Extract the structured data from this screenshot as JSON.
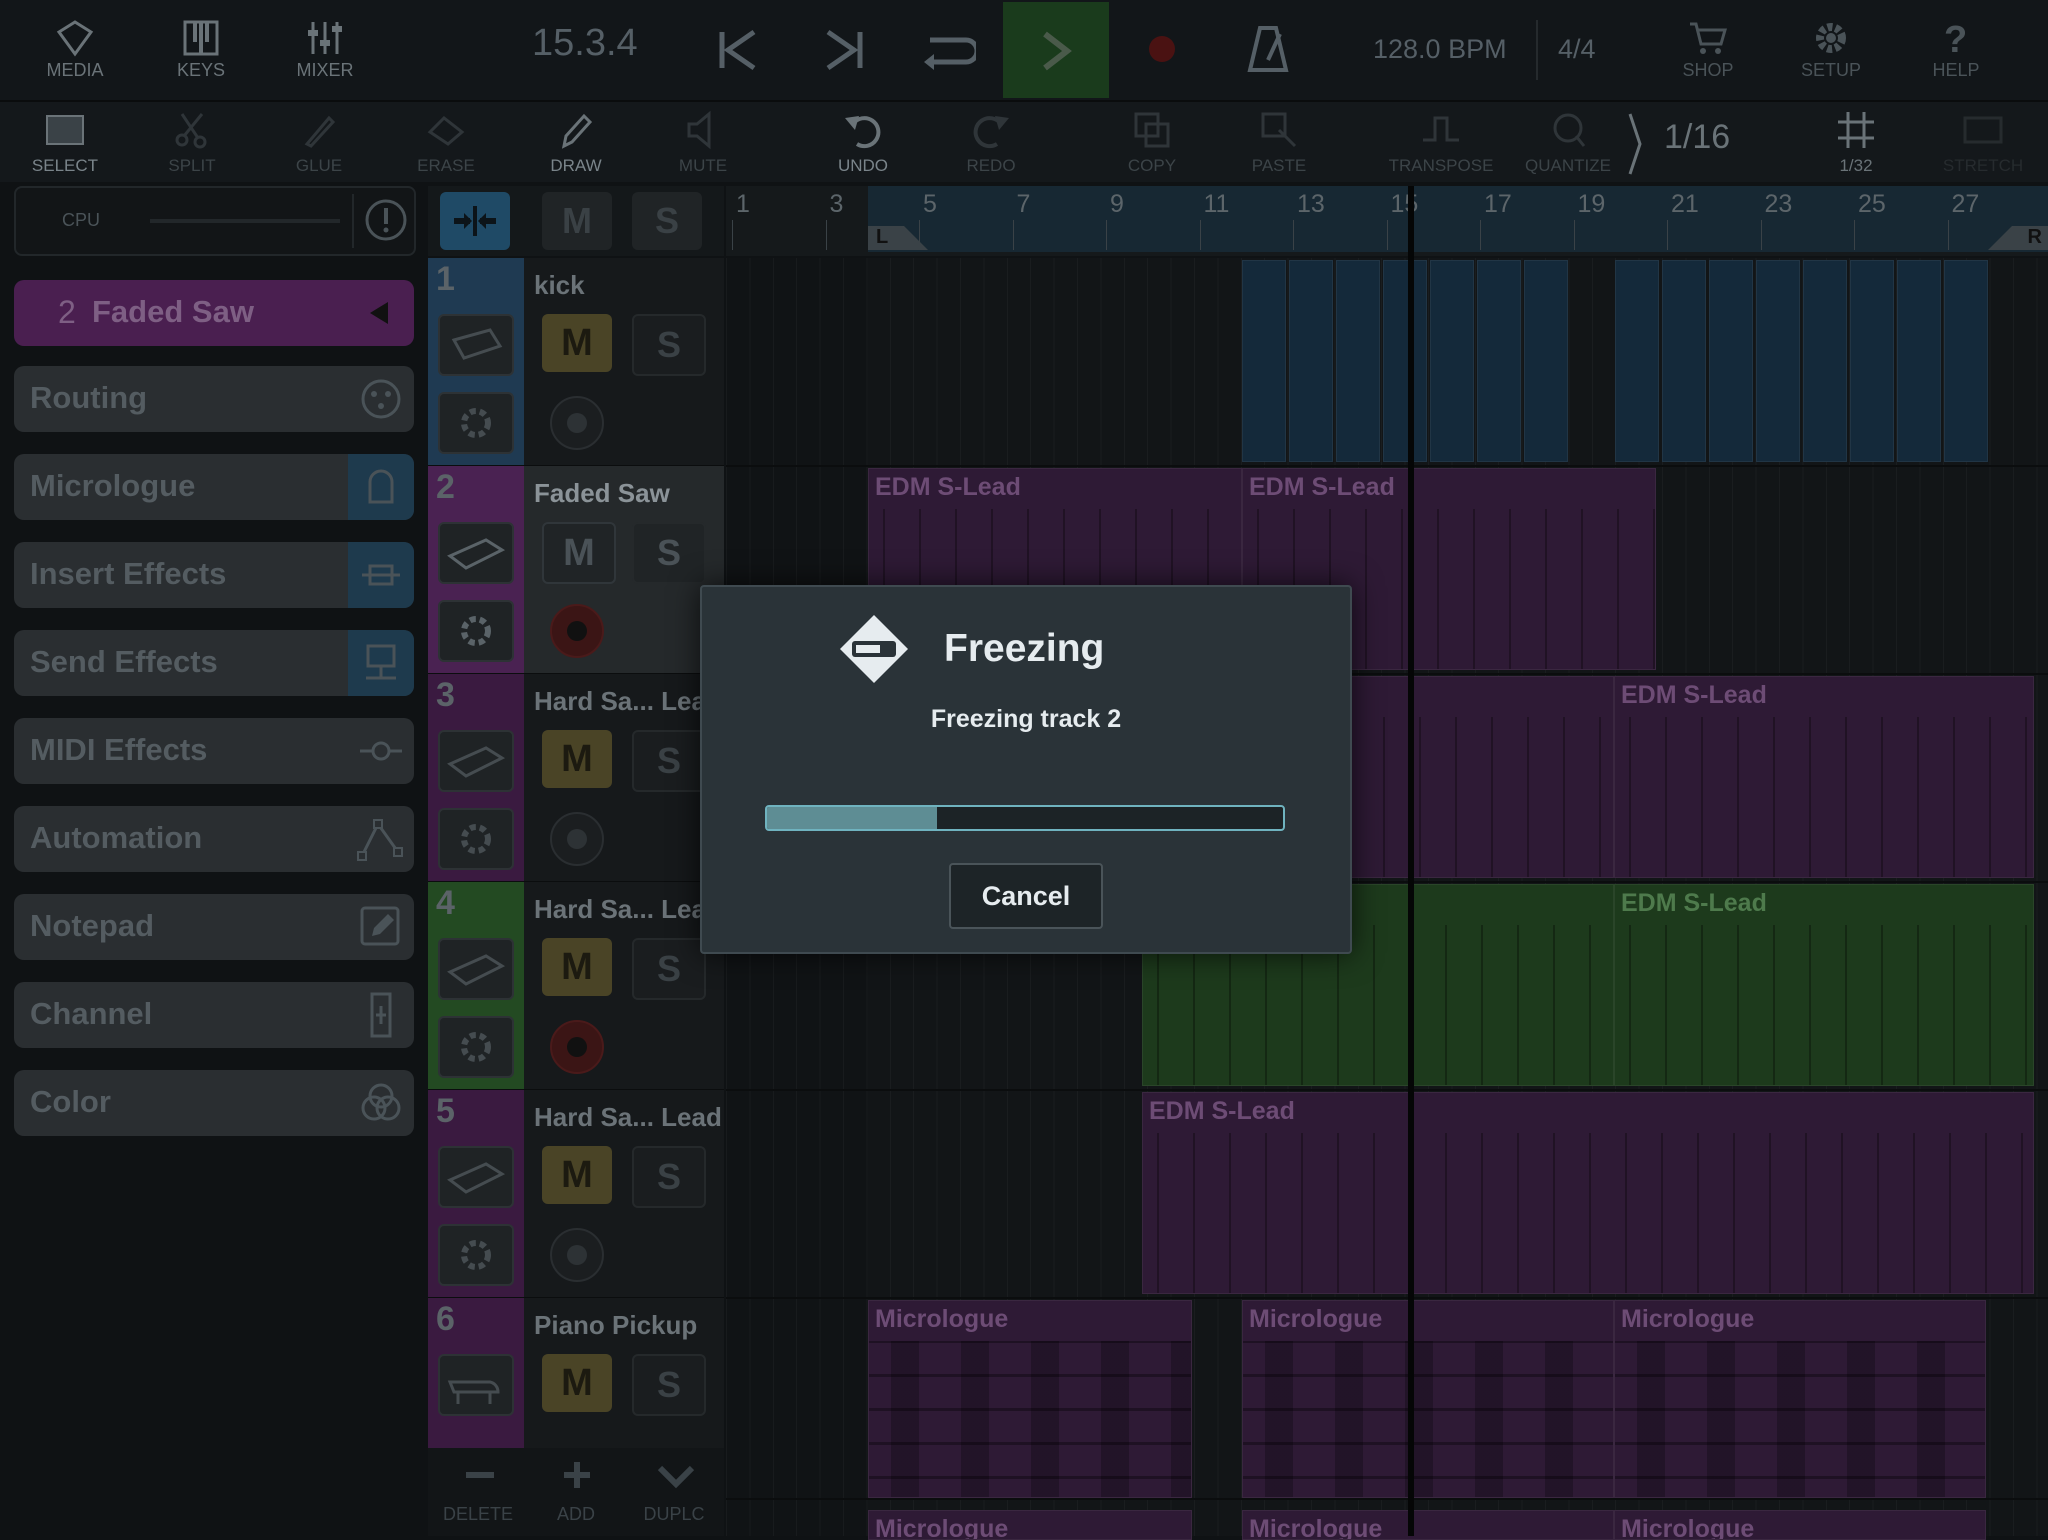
{
  "topbar": {
    "media": "MEDIA",
    "keys": "KEYS",
    "mixer": "MIXER",
    "position": "15.3.4",
    "tempo": "128.0 BPM",
    "signature": "4/4",
    "shop": "SHOP",
    "setup": "SETUP",
    "help": "HELP"
  },
  "editbar": {
    "select": "SELECT",
    "split": "SPLIT",
    "glue": "GLUE",
    "erase": "ERASE",
    "draw": "DRAW",
    "mute": "MUTE",
    "undo": "UNDO",
    "redo": "REDO",
    "copy": "COPY",
    "paste": "PASTE",
    "transpose": "TRANSPOSE",
    "quantize": "QUANTIZE",
    "quantize_value": "1/16",
    "grid_value": "1/32",
    "stretch": "STRETCH"
  },
  "sidebar": {
    "cpu_label": "CPU",
    "selected_track_num": "2",
    "selected_track_name": "Faded Saw",
    "items": [
      {
        "label": "Routing"
      },
      {
        "label": "Micrologue"
      },
      {
        "label": "Insert Effects"
      },
      {
        "label": "Send Effects"
      },
      {
        "label": "MIDI Effects"
      },
      {
        "label": "Automation"
      },
      {
        "label": "Notepad"
      },
      {
        "label": "Channel"
      },
      {
        "label": "Color"
      }
    ]
  },
  "track_header": {
    "mute": "M",
    "solo": "S"
  },
  "ruler": {
    "bars": [
      "1",
      "3",
      "5",
      "7",
      "9",
      "11",
      "13",
      "15",
      "17",
      "19",
      "21",
      "23",
      "25",
      "27"
    ],
    "loop_left": "L",
    "loop_right": "R"
  },
  "tracks": [
    {
      "num": "1",
      "name": "kick",
      "color": "#1f3a52"
    },
    {
      "num": "2",
      "name": "Faded Saw",
      "color": "#4a2252"
    },
    {
      "num": "3",
      "name": "Hard Sa... Lead",
      "color": "#4a2252"
    },
    {
      "num": "4",
      "name": "Hard Sa... Lead",
      "color": "#234a22"
    },
    {
      "num": "5",
      "name": "Hard Sa... Lead",
      "color": "#4a2252"
    },
    {
      "num": "6",
      "name": "Piano Pickup",
      "color": "#4a2252"
    }
  ],
  "clips": {
    "edm": "EDM S-Lead",
    "micrologue": "Micrologue"
  },
  "bottom": {
    "delete": "DELETE",
    "add": "ADD",
    "duplicate": "DUPLC"
  },
  "dialog": {
    "title": "Freezing",
    "message": "Freezing track 2",
    "progress": 0.33,
    "cancel": "Cancel"
  }
}
